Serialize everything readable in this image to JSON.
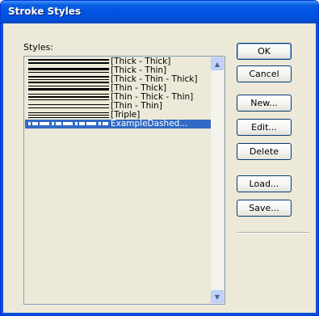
{
  "window": {
    "title": "Stroke Styles"
  },
  "styles_label": "Styles:",
  "styles_list": {
    "items": [
      {
        "label": "[Thick - Thick]",
        "stroke_pattern": "thick-thick"
      },
      {
        "label": "[Thick - Thin]",
        "stroke_pattern": "thick-thin"
      },
      {
        "label": "[Thick - Thin - Thick]",
        "stroke_pattern": "thick-thin-thick"
      },
      {
        "label": "[Thin - Thick]",
        "stroke_pattern": "thin-thick"
      },
      {
        "label": "[Thin - Thick - Thin]",
        "stroke_pattern": "thin-thick-thin"
      },
      {
        "label": "[Thin - Thin]",
        "stroke_pattern": "thin-thin"
      },
      {
        "label": "[Triple]",
        "stroke_pattern": "triple"
      },
      {
        "label": "ExampleDashed...",
        "stroke_pattern": "dashed"
      }
    ],
    "selected_label": "ExampleDashed..."
  },
  "buttons": {
    "ok": "OK",
    "cancel": "Cancel",
    "new": "New...",
    "edit": "Edit...",
    "delete": "Delete",
    "load": "Load...",
    "save": "Save..."
  },
  "icons": {
    "scroll_up": "scroll-up-arrow-icon",
    "scroll_down": "scroll-down-arrow-icon"
  },
  "colors": {
    "title_bar": "#0054e3",
    "selection": "#316ac5",
    "dialog_background": "#ece9d8"
  }
}
